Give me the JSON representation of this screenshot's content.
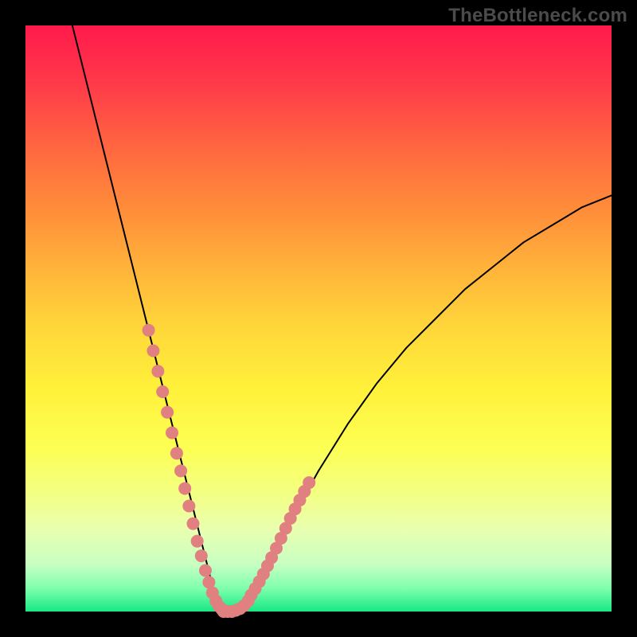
{
  "watermark": "TheBottleneck.com",
  "colors": {
    "frame_bg": "#000000",
    "dot_fill": "#e08080",
    "curve_stroke": "#000000",
    "gradient_stops": [
      "#ff1a4b",
      "#ff6b3e",
      "#ffb53a",
      "#fff13a",
      "#f3ff84",
      "#7fffad",
      "#17e885"
    ]
  },
  "chart_data": {
    "type": "line",
    "title": "",
    "xlabel": "",
    "ylabel": "",
    "xlim": [
      0,
      100
    ],
    "ylim": [
      0,
      100
    ],
    "grid": false,
    "legend_position": "none",
    "series": [
      {
        "name": "bottleneck-curve",
        "x": [
          8,
          10,
          12,
          14,
          16,
          18,
          20,
          22,
          24,
          26,
          27,
          28,
          29,
          30,
          31,
          32,
          33,
          34,
          35,
          36,
          38,
          40,
          42,
          45,
          50,
          55,
          60,
          65,
          70,
          75,
          80,
          85,
          90,
          95,
          100
        ],
        "y": [
          100,
          92,
          84,
          76,
          68,
          60,
          52,
          44,
          36,
          28,
          24,
          20,
          16,
          12,
          8,
          4,
          1,
          0,
          0,
          0.5,
          2,
          5,
          9,
          15,
          24,
          32,
          39,
          45,
          50,
          55,
          59,
          63,
          66,
          69,
          71
        ]
      }
    ],
    "points": [
      {
        "name": "left-cluster",
        "series": 0,
        "x": [
          21.0,
          21.8,
          22.6,
          23.4,
          24.2,
          25.0,
          25.8,
          26.5,
          27.2,
          27.9,
          28.6,
          29.3,
          30.0,
          30.7,
          31.3,
          31.9,
          32.5,
          33.0,
          33.5,
          34.0
        ],
        "y": [
          48.0,
          44.5,
          41.0,
          37.5,
          34.0,
          30.5,
          27.0,
          24.0,
          21.0,
          18.0,
          15.0,
          12.0,
          9.5,
          7.0,
          5.0,
          3.2,
          1.8,
          0.9,
          0.4,
          0.1
        ]
      },
      {
        "name": "bottom-cluster",
        "series": 0,
        "x": [
          33.8,
          34.5,
          35.2,
          35.9,
          36.6,
          37.3,
          38.0
        ],
        "y": [
          0.0,
          0.0,
          0.0,
          0.2,
          0.5,
          1.0,
          1.8
        ]
      },
      {
        "name": "right-cluster",
        "series": 0,
        "x": [
          38.5,
          39.2,
          39.9,
          40.6,
          41.3,
          42.0,
          42.8,
          43.6,
          44.4,
          45.2,
          46.0,
          46.8,
          47.6,
          48.4
        ],
        "y": [
          2.8,
          3.9,
          5.1,
          6.4,
          7.8,
          9.2,
          10.8,
          12.5,
          14.2,
          15.9,
          17.5,
          19.0,
          20.5,
          22.0
        ]
      }
    ],
    "annotations": []
  }
}
